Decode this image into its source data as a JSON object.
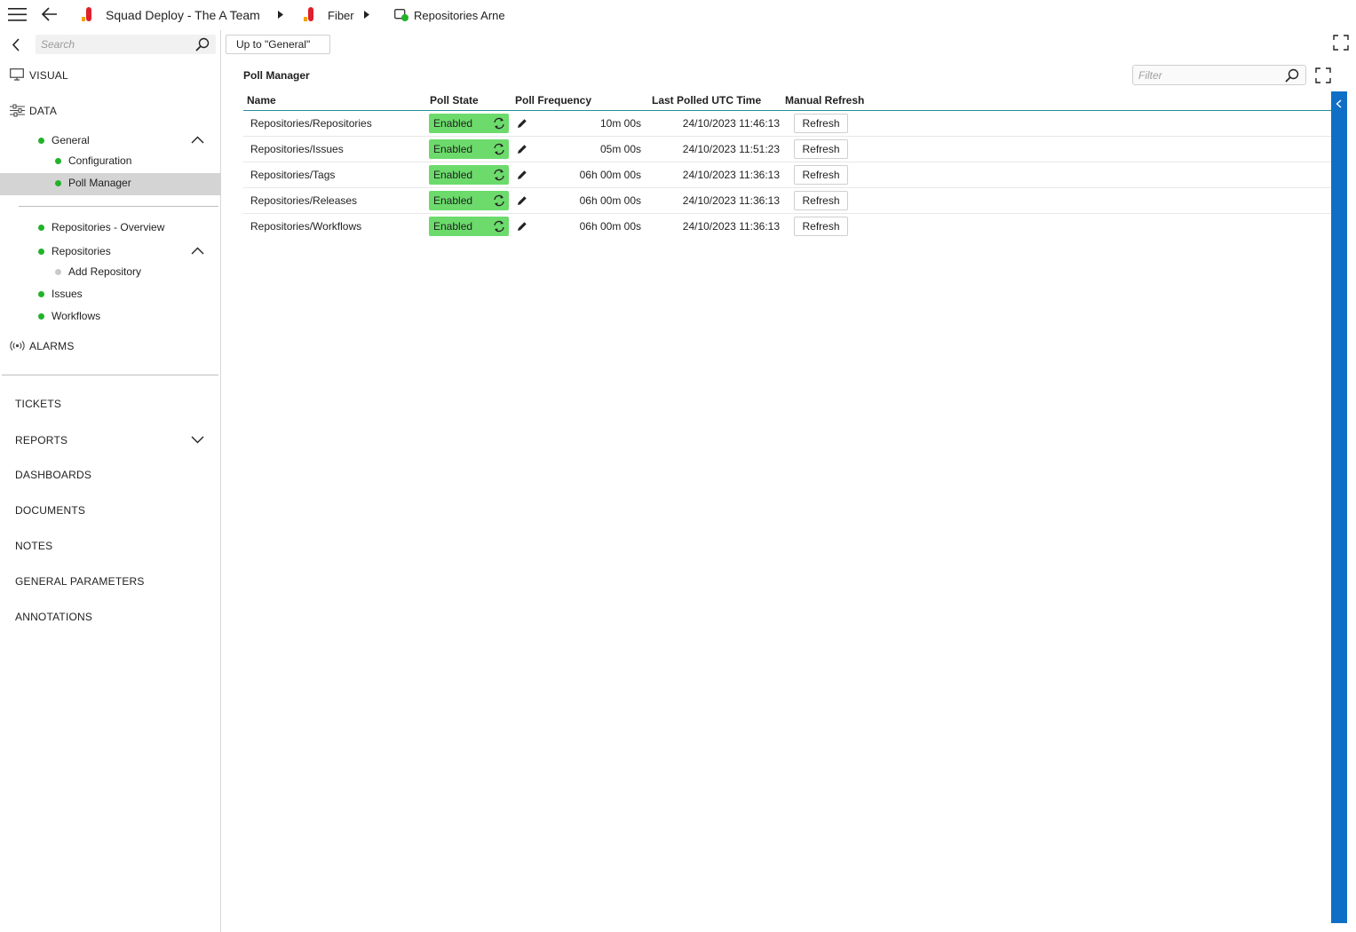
{
  "breadcrumb": {
    "item1": "Squad Deploy - The A Team",
    "item2": "Fiber",
    "item3": "Repositories Arne"
  },
  "sidebar": {
    "search_placeholder": "Search",
    "sections": {
      "visual": "VISUAL",
      "data": "DATA",
      "alarms": "ALARMS"
    },
    "tree": {
      "general": "General",
      "configuration": "Configuration",
      "poll_manager": "Poll Manager",
      "repositories_overview": "Repositories - Overview",
      "repositories": "Repositories",
      "add_repository": "Add Repository",
      "issues": "Issues",
      "workflows": "Workflows"
    },
    "nav": {
      "tickets": "TICKETS",
      "reports": "REPORTS",
      "dashboards": "DASHBOARDS",
      "documents": "DOCUMENTS",
      "notes": "NOTES",
      "general_parameters": "GENERAL PARAMETERS",
      "annotations": "ANNOTATIONS"
    }
  },
  "main": {
    "up_button": "Up to \"General\"",
    "title": "Poll Manager",
    "filter_placeholder": "Filter",
    "columns": {
      "name": "Name",
      "state": "Poll State",
      "frequency": "Poll Frequency",
      "last_polled": "Last Polled UTC Time",
      "manual_refresh": "Manual Refresh"
    },
    "rows": [
      {
        "name": "Repositories/Repositories",
        "state": "Enabled",
        "frequency": "10m 00s",
        "last_polled": "24/10/2023 11:46:13",
        "refresh": "Refresh"
      },
      {
        "name": "Repositories/Issues",
        "state": "Enabled",
        "frequency": "05m 00s",
        "last_polled": "24/10/2023 11:51:23",
        "refresh": "Refresh"
      },
      {
        "name": "Repositories/Tags",
        "state": "Enabled",
        "frequency": "06h 00m 00s",
        "last_polled": "24/10/2023 11:36:13",
        "refresh": "Refresh"
      },
      {
        "name": "Repositories/Releases",
        "state": "Enabled",
        "frequency": "06h 00m 00s",
        "last_polled": "24/10/2023 11:36:13",
        "refresh": "Refresh"
      },
      {
        "name": "Repositories/Workflows",
        "state": "Enabled",
        "frequency": "06h 00m 00s",
        "last_polled": "24/10/2023 11:36:13",
        "refresh": "Refresh"
      }
    ]
  },
  "colors": {
    "enabled": "#6cdb6c",
    "status_dot": "#22b22a",
    "accent_strip": "#0f6fc6",
    "header_rule": "#2a8a96"
  },
  "icons": [
    "hamburger-icon",
    "back-arrow-icon",
    "element-icon",
    "caret-right-icon",
    "service-icon",
    "chevron-left-icon",
    "search-icon",
    "monitor-icon",
    "sliders-icon",
    "chevron-up-icon",
    "chevron-down-icon",
    "antenna-icon",
    "fullscreen-icon",
    "sync-icon",
    "pencil-icon",
    "collapse-icon"
  ]
}
